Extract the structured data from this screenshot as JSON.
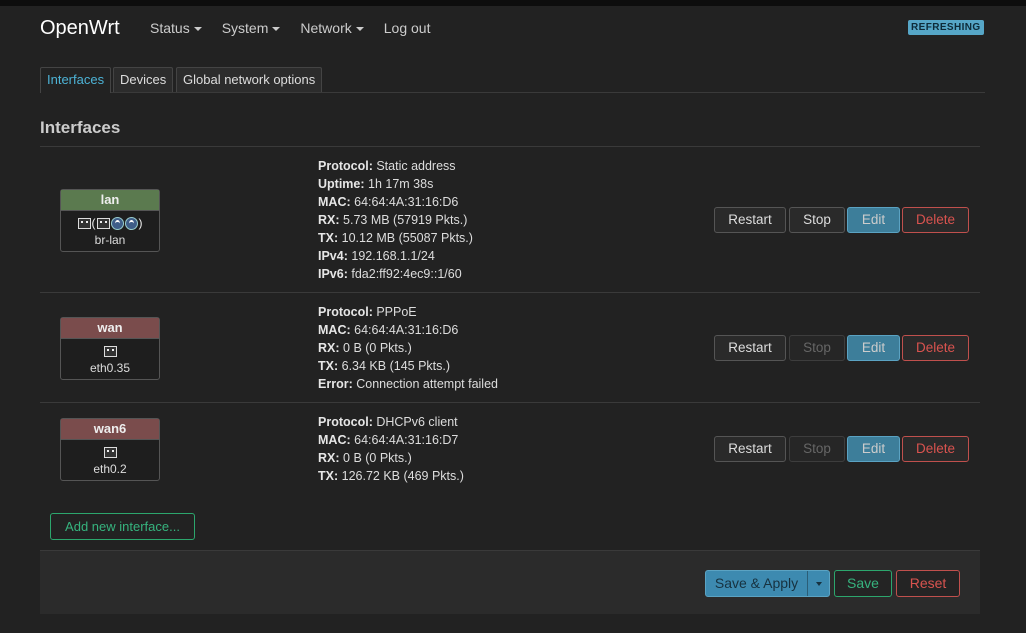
{
  "header": {
    "brand": "OpenWrt",
    "nav": [
      {
        "label": "Status",
        "dropdown": true
      },
      {
        "label": "System",
        "dropdown": true
      },
      {
        "label": "Network",
        "dropdown": true
      },
      {
        "label": "Log out",
        "dropdown": false
      }
    ],
    "badge": "REFRESHING"
  },
  "tabs": [
    {
      "label": "Interfaces",
      "active": true
    },
    {
      "label": "Devices",
      "active": false
    },
    {
      "label": "Global network options",
      "active": false
    }
  ],
  "section_title": "Interfaces",
  "interfaces": [
    {
      "name": "lan",
      "color": "#5b7a4f",
      "icons": [
        "ethernet-icon",
        "bridge-icon",
        "wifi-icon",
        "wifi-icon"
      ],
      "device": "br-lan",
      "info": [
        {
          "key": "Protocol:",
          "value": "Static address"
        },
        {
          "key": "Uptime:",
          "value": "1h 17m 38s"
        },
        {
          "key": "MAC:",
          "value": "64:64:4A:31:16:D6"
        },
        {
          "key": "RX:",
          "value": "5.73 MB (57919 Pkts.)"
        },
        {
          "key": "TX:",
          "value": "10.12 MB (55087 Pkts.)"
        },
        {
          "key": "IPv4:",
          "value": "192.168.1.1/24"
        },
        {
          "key": "IPv6:",
          "value": "fda2:ff92:4ec9::1/60"
        }
      ],
      "stop_disabled": false
    },
    {
      "name": "wan",
      "color": "#7a4c4c",
      "icons": [
        "ethernet-icon"
      ],
      "device": "eth0.35",
      "info": [
        {
          "key": "Protocol:",
          "value": "PPPoE"
        },
        {
          "key": "MAC:",
          "value": "64:64:4A:31:16:D6"
        },
        {
          "key": "RX:",
          "value": "0 B (0 Pkts.)"
        },
        {
          "key": "TX:",
          "value": "6.34 KB (145 Pkts.)"
        },
        {
          "key": "Error:",
          "value": "Connection attempt failed"
        }
      ],
      "stop_disabled": true
    },
    {
      "name": "wan6",
      "color": "#7a4c4c",
      "icons": [
        "ethernet-icon"
      ],
      "device": "eth0.2",
      "info": [
        {
          "key": "Protocol:",
          "value": "DHCPv6 client"
        },
        {
          "key": "MAC:",
          "value": "64:64:4A:31:16:D7"
        },
        {
          "key": "RX:",
          "value": "0 B (0 Pkts.)"
        },
        {
          "key": "TX:",
          "value": "126.72 KB (469 Pkts.)"
        }
      ],
      "stop_disabled": true
    }
  ],
  "row_buttons": {
    "restart": "Restart",
    "stop": "Stop",
    "edit": "Edit",
    "delete": "Delete"
  },
  "add_interface_label": "Add new interface...",
  "footer": {
    "save_apply": "Save & Apply",
    "save": "Save",
    "reset": "Reset"
  }
}
